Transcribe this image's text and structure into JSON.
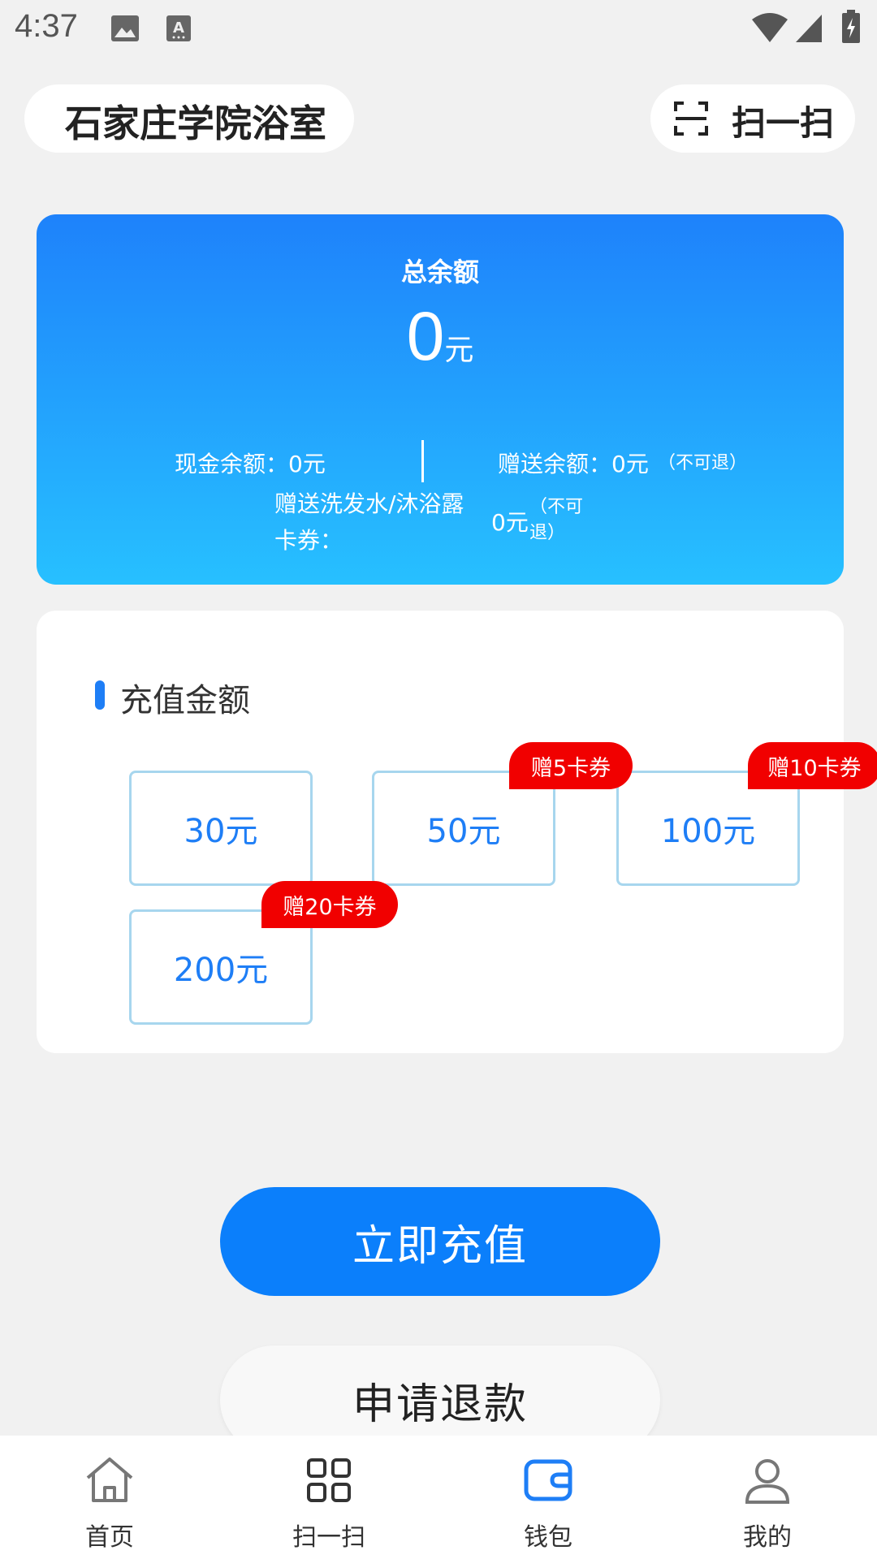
{
  "status_bar": {
    "time": "4:37"
  },
  "header": {
    "campus_name": "石家庄学院浴室",
    "scan_label": "扫一扫"
  },
  "balance": {
    "title": "总余额",
    "amount": "0",
    "unit": "元",
    "cash_label": "现金余额：0元",
    "gift_label": "赠送余额：0元",
    "gift_note": "（不可退）",
    "coupon_label_line1": "赠送洗发水/沐浴露",
    "coupon_label_line2": "卡券：",
    "coupon_value": "0元",
    "coupon_note_line1": "（不可",
    "coupon_note_line2": "退）"
  },
  "recharge": {
    "title": "充值金额",
    "options": [
      {
        "label": "30元",
        "bonus": ""
      },
      {
        "label": "50元",
        "bonus": "赠5卡券"
      },
      {
        "label": "100元",
        "bonus": "赠10卡券"
      },
      {
        "label": "200元",
        "bonus": "赠20卡券"
      }
    ]
  },
  "actions": {
    "recharge_now": "立即充值",
    "apply_refund": "申请退款"
  },
  "tabbar": {
    "items": [
      {
        "label": "首页",
        "icon": "home-icon"
      },
      {
        "label": "扫一扫",
        "icon": "grid-icon"
      },
      {
        "label": "钱包",
        "icon": "wallet-icon"
      },
      {
        "label": "我的",
        "icon": "user-icon"
      }
    ],
    "active_index": 2
  },
  "colors": {
    "accent": "#0b7ffb",
    "card_gradient_top": "#1e82fb",
    "card_gradient_bottom": "#27c0ff",
    "bonus_tag": "#f10000",
    "option_border": "#a7d6ee"
  }
}
